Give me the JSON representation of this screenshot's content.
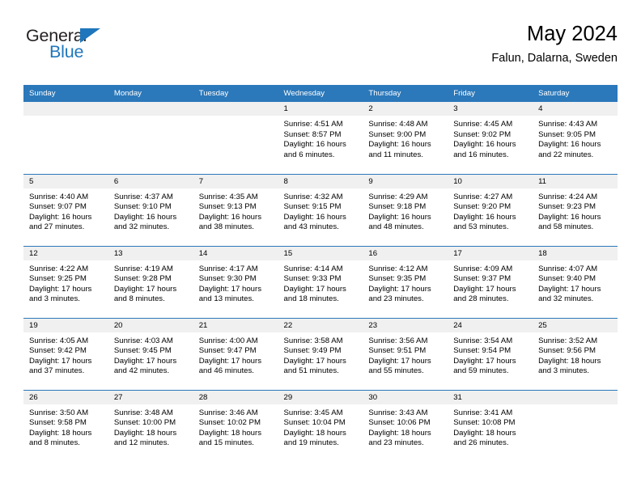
{
  "brand": {
    "name_top": "General",
    "name_bottom": "Blue",
    "accent_color": "#1f76bc"
  },
  "header": {
    "title": "May 2024",
    "subtitle": "Falun, Dalarna, Sweden"
  },
  "theme": {
    "header_bg": "#2b78ba",
    "daynum_bg": "#f0f0f0",
    "text": "#000000"
  },
  "weekdays": [
    "Sunday",
    "Monday",
    "Tuesday",
    "Wednesday",
    "Thursday",
    "Friday",
    "Saturday"
  ],
  "labels": {
    "sunrise": "Sunrise:",
    "sunset": "Sunset:",
    "daylight": "Daylight:"
  },
  "weeks": [
    [
      {
        "day": ""
      },
      {
        "day": ""
      },
      {
        "day": ""
      },
      {
        "day": "1",
        "sunrise": "Sunrise: 4:51 AM",
        "sunset": "Sunset: 8:57 PM",
        "daylight1": "Daylight: 16 hours",
        "daylight2": "and 6 minutes."
      },
      {
        "day": "2",
        "sunrise": "Sunrise: 4:48 AM",
        "sunset": "Sunset: 9:00 PM",
        "daylight1": "Daylight: 16 hours",
        "daylight2": "and 11 minutes."
      },
      {
        "day": "3",
        "sunrise": "Sunrise: 4:45 AM",
        "sunset": "Sunset: 9:02 PM",
        "daylight1": "Daylight: 16 hours",
        "daylight2": "and 16 minutes."
      },
      {
        "day": "4",
        "sunrise": "Sunrise: 4:43 AM",
        "sunset": "Sunset: 9:05 PM",
        "daylight1": "Daylight: 16 hours",
        "daylight2": "and 22 minutes."
      }
    ],
    [
      {
        "day": "5",
        "sunrise": "Sunrise: 4:40 AM",
        "sunset": "Sunset: 9:07 PM",
        "daylight1": "Daylight: 16 hours",
        "daylight2": "and 27 minutes."
      },
      {
        "day": "6",
        "sunrise": "Sunrise: 4:37 AM",
        "sunset": "Sunset: 9:10 PM",
        "daylight1": "Daylight: 16 hours",
        "daylight2": "and 32 minutes."
      },
      {
        "day": "7",
        "sunrise": "Sunrise: 4:35 AM",
        "sunset": "Sunset: 9:13 PM",
        "daylight1": "Daylight: 16 hours",
        "daylight2": "and 38 minutes."
      },
      {
        "day": "8",
        "sunrise": "Sunrise: 4:32 AM",
        "sunset": "Sunset: 9:15 PM",
        "daylight1": "Daylight: 16 hours",
        "daylight2": "and 43 minutes."
      },
      {
        "day": "9",
        "sunrise": "Sunrise: 4:29 AM",
        "sunset": "Sunset: 9:18 PM",
        "daylight1": "Daylight: 16 hours",
        "daylight2": "and 48 minutes."
      },
      {
        "day": "10",
        "sunrise": "Sunrise: 4:27 AM",
        "sunset": "Sunset: 9:20 PM",
        "daylight1": "Daylight: 16 hours",
        "daylight2": "and 53 minutes."
      },
      {
        "day": "11",
        "sunrise": "Sunrise: 4:24 AM",
        "sunset": "Sunset: 9:23 PM",
        "daylight1": "Daylight: 16 hours",
        "daylight2": "and 58 minutes."
      }
    ],
    [
      {
        "day": "12",
        "sunrise": "Sunrise: 4:22 AM",
        "sunset": "Sunset: 9:25 PM",
        "daylight1": "Daylight: 17 hours",
        "daylight2": "and 3 minutes."
      },
      {
        "day": "13",
        "sunrise": "Sunrise: 4:19 AM",
        "sunset": "Sunset: 9:28 PM",
        "daylight1": "Daylight: 17 hours",
        "daylight2": "and 8 minutes."
      },
      {
        "day": "14",
        "sunrise": "Sunrise: 4:17 AM",
        "sunset": "Sunset: 9:30 PM",
        "daylight1": "Daylight: 17 hours",
        "daylight2": "and 13 minutes."
      },
      {
        "day": "15",
        "sunrise": "Sunrise: 4:14 AM",
        "sunset": "Sunset: 9:33 PM",
        "daylight1": "Daylight: 17 hours",
        "daylight2": "and 18 minutes."
      },
      {
        "day": "16",
        "sunrise": "Sunrise: 4:12 AM",
        "sunset": "Sunset: 9:35 PM",
        "daylight1": "Daylight: 17 hours",
        "daylight2": "and 23 minutes."
      },
      {
        "day": "17",
        "sunrise": "Sunrise: 4:09 AM",
        "sunset": "Sunset: 9:37 PM",
        "daylight1": "Daylight: 17 hours",
        "daylight2": "and 28 minutes."
      },
      {
        "day": "18",
        "sunrise": "Sunrise: 4:07 AM",
        "sunset": "Sunset: 9:40 PM",
        "daylight1": "Daylight: 17 hours",
        "daylight2": "and 32 minutes."
      }
    ],
    [
      {
        "day": "19",
        "sunrise": "Sunrise: 4:05 AM",
        "sunset": "Sunset: 9:42 PM",
        "daylight1": "Daylight: 17 hours",
        "daylight2": "and 37 minutes."
      },
      {
        "day": "20",
        "sunrise": "Sunrise: 4:03 AM",
        "sunset": "Sunset: 9:45 PM",
        "daylight1": "Daylight: 17 hours",
        "daylight2": "and 42 minutes."
      },
      {
        "day": "21",
        "sunrise": "Sunrise: 4:00 AM",
        "sunset": "Sunset: 9:47 PM",
        "daylight1": "Daylight: 17 hours",
        "daylight2": "and 46 minutes."
      },
      {
        "day": "22",
        "sunrise": "Sunrise: 3:58 AM",
        "sunset": "Sunset: 9:49 PM",
        "daylight1": "Daylight: 17 hours",
        "daylight2": "and 51 minutes."
      },
      {
        "day": "23",
        "sunrise": "Sunrise: 3:56 AM",
        "sunset": "Sunset: 9:51 PM",
        "daylight1": "Daylight: 17 hours",
        "daylight2": "and 55 minutes."
      },
      {
        "day": "24",
        "sunrise": "Sunrise: 3:54 AM",
        "sunset": "Sunset: 9:54 PM",
        "daylight1": "Daylight: 17 hours",
        "daylight2": "and 59 minutes."
      },
      {
        "day": "25",
        "sunrise": "Sunrise: 3:52 AM",
        "sunset": "Sunset: 9:56 PM",
        "daylight1": "Daylight: 18 hours",
        "daylight2": "and 3 minutes."
      }
    ],
    [
      {
        "day": "26",
        "sunrise": "Sunrise: 3:50 AM",
        "sunset": "Sunset: 9:58 PM",
        "daylight1": "Daylight: 18 hours",
        "daylight2": "and 8 minutes."
      },
      {
        "day": "27",
        "sunrise": "Sunrise: 3:48 AM",
        "sunset": "Sunset: 10:00 PM",
        "daylight1": "Daylight: 18 hours",
        "daylight2": "and 12 minutes."
      },
      {
        "day": "28",
        "sunrise": "Sunrise: 3:46 AM",
        "sunset": "Sunset: 10:02 PM",
        "daylight1": "Daylight: 18 hours",
        "daylight2": "and 15 minutes."
      },
      {
        "day": "29",
        "sunrise": "Sunrise: 3:45 AM",
        "sunset": "Sunset: 10:04 PM",
        "daylight1": "Daylight: 18 hours",
        "daylight2": "and 19 minutes."
      },
      {
        "day": "30",
        "sunrise": "Sunrise: 3:43 AM",
        "sunset": "Sunset: 10:06 PM",
        "daylight1": "Daylight: 18 hours",
        "daylight2": "and 23 minutes."
      },
      {
        "day": "31",
        "sunrise": "Sunrise: 3:41 AM",
        "sunset": "Sunset: 10:08 PM",
        "daylight1": "Daylight: 18 hours",
        "daylight2": "and 26 minutes."
      },
      {
        "day": ""
      }
    ]
  ]
}
